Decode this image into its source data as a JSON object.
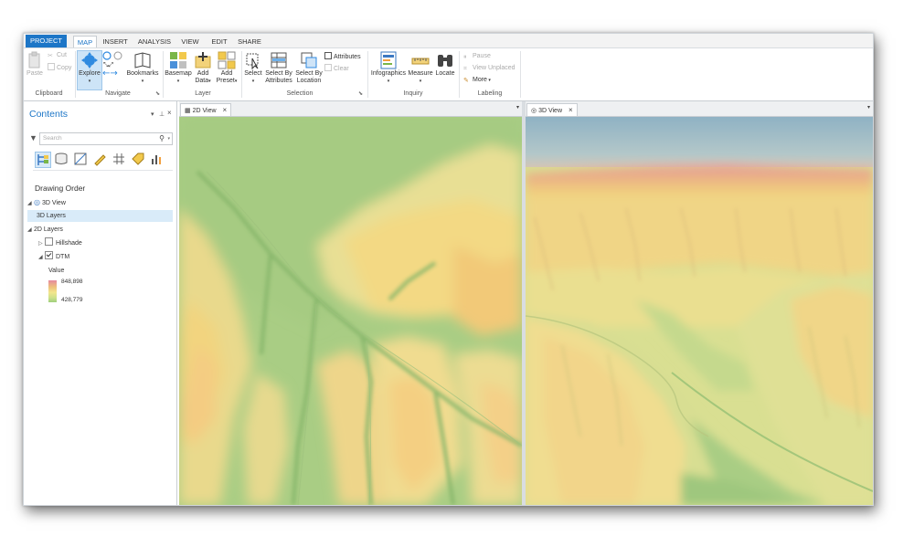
{
  "ribbon_tabs": [
    "PROJECT",
    "MAP",
    "INSERT",
    "ANALYSIS",
    "VIEW",
    "EDIT",
    "SHARE"
  ],
  "clipboard": {
    "paste": "Paste",
    "cut": "Cut",
    "copy": "Copy",
    "label": "Clipboard"
  },
  "navigate": {
    "explore": "Explore",
    "bookmarks": "Bookmarks",
    "label": "Navigate"
  },
  "layer": {
    "basemap": "Basemap",
    "add_data_1": "Add",
    "add_data_2": "Data",
    "add_preset_1": "Add",
    "add_preset_2": "Preset",
    "label": "Layer"
  },
  "selection": {
    "select": "Select",
    "select_attr_1": "Select By",
    "select_attr_2": "Attributes",
    "select_loc_1": "Select By",
    "select_loc_2": "Location",
    "attributes": "Attributes",
    "clear": "Clear",
    "label": "Selection"
  },
  "inquiry": {
    "infographics": "Infographics",
    "measure": "Measure",
    "locate": "Locate",
    "label": "Inquiry"
  },
  "labeling": {
    "pause": "Pause",
    "view_unplaced": "View Unplaced",
    "more": "More",
    "label": "Labeling"
  },
  "contents": {
    "title": "Contents",
    "search_placeholder": "Search",
    "heading": "Drawing Order",
    "tree": {
      "view3d": "3D View",
      "layers3d": "3D Layers",
      "layers2d": "2D Layers",
      "hillshade": "Hillshade",
      "dtm": "DTM",
      "value": "Value",
      "max": "848,898",
      "min": "428,779"
    }
  },
  "views": {
    "view2d": "2D View",
    "view3d": "3D View"
  },
  "colors": {
    "accent": "#1d76c7",
    "selected_row": "#d9ebf9"
  },
  "icons": [
    "paste-icon",
    "cut-icon",
    "copy-icon",
    "explore-icon",
    "bookmarks-icon",
    "basemap-icon",
    "add-data-icon",
    "add-preset-icon",
    "select-icon",
    "select-by-attributes-icon",
    "select-by-location-icon",
    "infographics-icon",
    "measure-icon",
    "locate-icon",
    "filter-icon",
    "search-icon",
    "globe-icon",
    "close-icon"
  ]
}
